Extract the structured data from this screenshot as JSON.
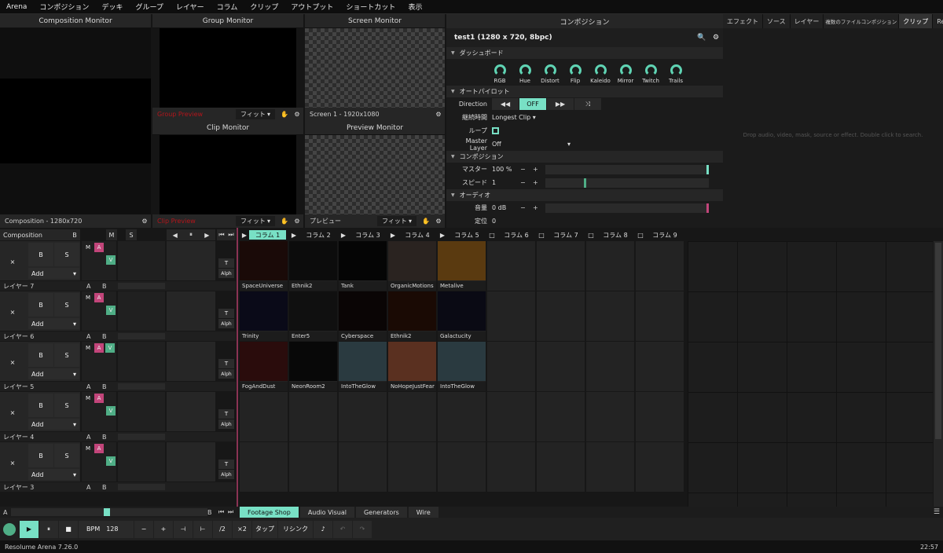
{
  "menu": [
    "Arena",
    "コンポジション",
    "デッキ",
    "グループ",
    "レイヤー",
    "コラム",
    "クリップ",
    "アウトプット",
    "ショートカット",
    "表示"
  ],
  "monitors": {
    "composition": {
      "title": "Composition Monitor",
      "footer": "Composition - 1280x720"
    },
    "group": {
      "title": "Group Monitor",
      "footer": "Group Preview",
      "fit": "フィット"
    },
    "clip": {
      "title": "Clip Monitor",
      "footer": "Clip Preview",
      "fit": "フィット"
    },
    "screen": {
      "title": "Screen Monitor",
      "footer": "Screen 1 - 1920x1080"
    },
    "preview": {
      "title": "Preview Monitor",
      "footer": "プレビュー",
      "fit": "フィット"
    }
  },
  "composition_panel": {
    "title": "コンポジション",
    "name": "test1 (1280 x 720, 8bpc)",
    "dashboard": "ダッシュボード",
    "knobs": [
      "RGB",
      "Hue",
      "Distort",
      "Flip",
      "Kaleido",
      "Mirror",
      "Twitch",
      "Trails"
    ],
    "autopilot": "オートパイロット",
    "direction_label": "Direction",
    "direction_value": "OFF",
    "duration_label": "継続時間",
    "duration_value": "Longest Clip",
    "loop_label": "ループ",
    "master_layer_label": "Master Layer",
    "master_layer_value": "Off",
    "comp_section": "コンポジション",
    "master_label": "マスター",
    "master_value": "100 %",
    "master_level": 1.0,
    "speed_label": "スピード",
    "speed_value": "1",
    "speed_level": 0.25,
    "audio_section": "オーディオ",
    "volume_label": "音量",
    "volume_value": "0 dB",
    "pan_label": "定位",
    "pan_value": "0"
  },
  "right_panel": {
    "tabs": [
      "エフェクト",
      "ソース",
      "レイヤー",
      "複数のファイルコンポジション",
      "クリップ",
      "Record"
    ],
    "active_tab": "クリップ",
    "drop_text": "Drop audio, video, mask, source or effect. Double click to search."
  },
  "deck": {
    "composition_label": "Composition",
    "columns": [
      "コラム 1",
      "コラム 2",
      "コラム 3",
      "コラム 4",
      "コラム 5",
      "コラム 6",
      "コラム 7",
      "コラム 8",
      "コラム 9"
    ],
    "layers": [
      {
        "name": "レイヤー 7",
        "clips": [
          "SpaceUniverse",
          "Ethnik2",
          "Tank",
          "OrganicMotions",
          "Metalive"
        ]
      },
      {
        "name": "レイヤー 6",
        "clips": [
          "Trinity",
          "Enter5",
          "Cyberspace",
          "Ethnik2",
          "Galactucity"
        ]
      },
      {
        "name": "レイヤー 5",
        "clips": [
          "FogAndDust",
          "NeonRoom2",
          "IntoTheGlow",
          "NoHopeJustFear",
          "IntoTheGlow"
        ]
      },
      {
        "name": "レイヤー 4",
        "clips": []
      },
      {
        "name": "レイヤー 3",
        "clips": []
      }
    ],
    "add_label": "Add",
    "b_label": "B",
    "s_label": "S",
    "x_label": "×",
    "m_label": "M",
    "a_label": "A",
    "v_label": "V",
    "t_label": "T",
    "alph_label": "Alph"
  },
  "bottom_tabs": [
    "Footage Shop",
    "Audio Visual",
    "Generators",
    "Wire"
  ],
  "transport": {
    "bpm_label": "BPM",
    "bpm_value": "128",
    "buttons": [
      "−",
      "+",
      "⊣",
      "⊢",
      "/2",
      "×2",
      "タップ",
      "リシンク"
    ]
  },
  "status": {
    "app": "Resolume Arena 7.26.0",
    "time": "22:57"
  },
  "colors": {
    "accent": "#78e0c5",
    "pink": "#c2457a",
    "green": "#4fae86",
    "red": "#b3151b"
  }
}
